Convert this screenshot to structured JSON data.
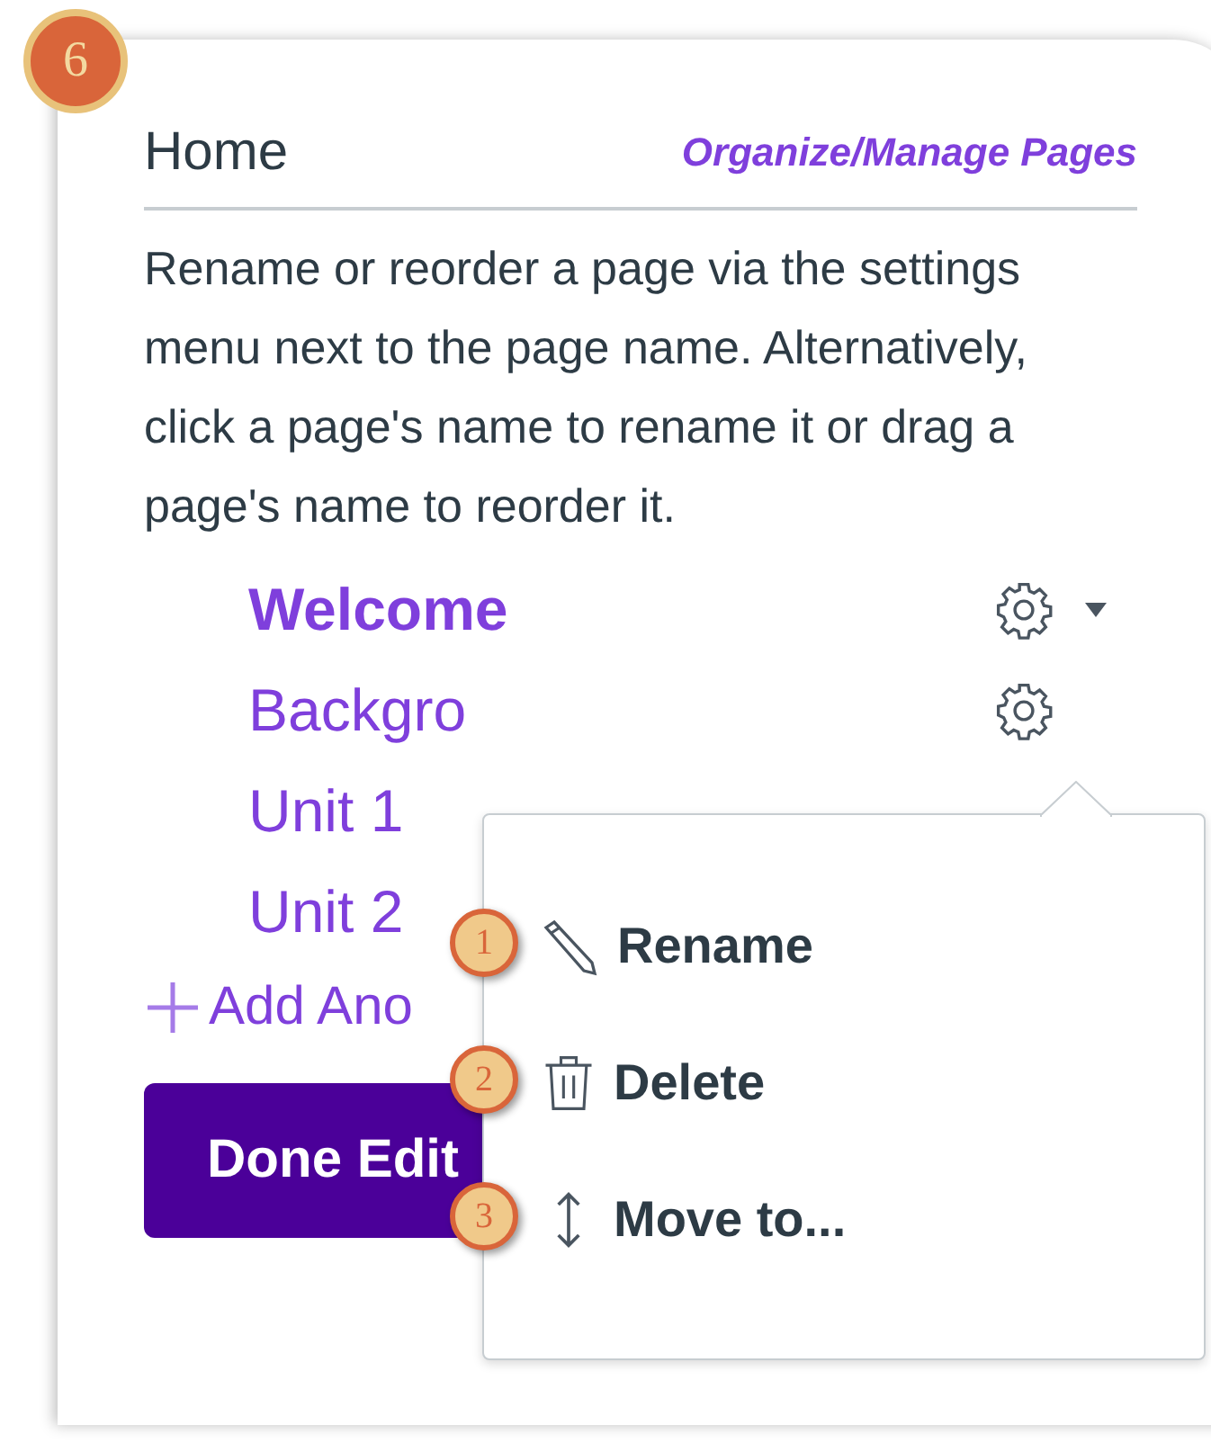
{
  "step_badge": "6",
  "panel": {
    "title": "Home",
    "link": "Organize/Manage Pages",
    "instructions": "Rename or reorder a page via the settings menu next to the page name. Alternatively, click a page's name to rename it or drag a page's name to reorder it."
  },
  "pages": [
    {
      "name": "Welcome",
      "selected": true,
      "menu_open": true,
      "gear": true
    },
    {
      "name": "Backgro",
      "selected": false,
      "menu_open": false,
      "gear": true
    },
    {
      "name": "Unit 1",
      "selected": false,
      "menu_open": false,
      "gear": false
    },
    {
      "name": "Unit 2",
      "selected": false,
      "menu_open": false,
      "gear": false
    }
  ],
  "add_link": "Add Ano",
  "done_button": "Done Edit",
  "menu": [
    {
      "kind": "rename",
      "label": "Rename",
      "callout": "1"
    },
    {
      "kind": "delete",
      "label": "Delete",
      "callout": "2"
    },
    {
      "kind": "move",
      "label": "Move to...",
      "callout": "3"
    }
  ]
}
